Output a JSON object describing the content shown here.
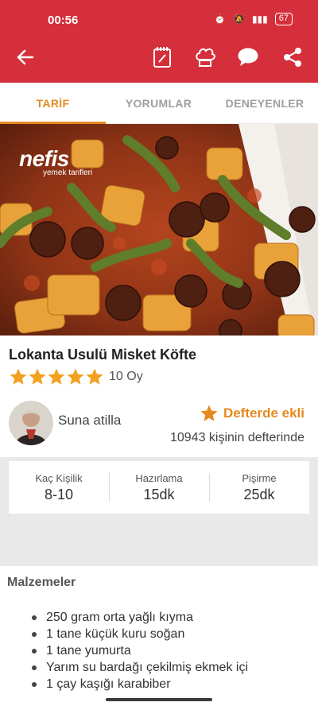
{
  "status_bar": {
    "time": "00:56",
    "battery": "67"
  },
  "toolbar": {
    "back_icon": "arrow-left-icon",
    "icons": [
      "notebook-icon",
      "chef-hat-icon",
      "comment-icon",
      "share-icon"
    ]
  },
  "tabs": [
    {
      "label": "TARİF",
      "active": true
    },
    {
      "label": "YORUMLAR",
      "active": false
    },
    {
      "label": "DENEYENLER",
      "active": false
    }
  ],
  "hero": {
    "logo_text": "nefis",
    "logo_sub": "yemek tarifleri"
  },
  "recipe": {
    "title": "Lokanta Usulü Misket Köfte",
    "rating": 5,
    "votes": "10 Oy"
  },
  "author": {
    "name": "Suna atilla",
    "notebook_label": "Defterde ekli",
    "notebook_count": "10943 kişinin defterinde"
  },
  "info": [
    {
      "label": "Kaç Kişilik",
      "value": "8-10"
    },
    {
      "label": "Hazırlama",
      "value": "15dk"
    },
    {
      "label": "Pişirme",
      "value": "25dk"
    }
  ],
  "ingredients": {
    "title": "Malzemeler",
    "items": [
      "250 gram orta yağlı kıyma",
      "1 tane küçük kuru soğan",
      "1 tane yumurta",
      "Yarım su bardağı çekilmiş ekmek içi",
      "1 çay kaşığı karabiber"
    ]
  },
  "colors": {
    "brand_red": "#d52f3b",
    "accent_orange": "#e58a1f",
    "star": "#f2a121"
  }
}
